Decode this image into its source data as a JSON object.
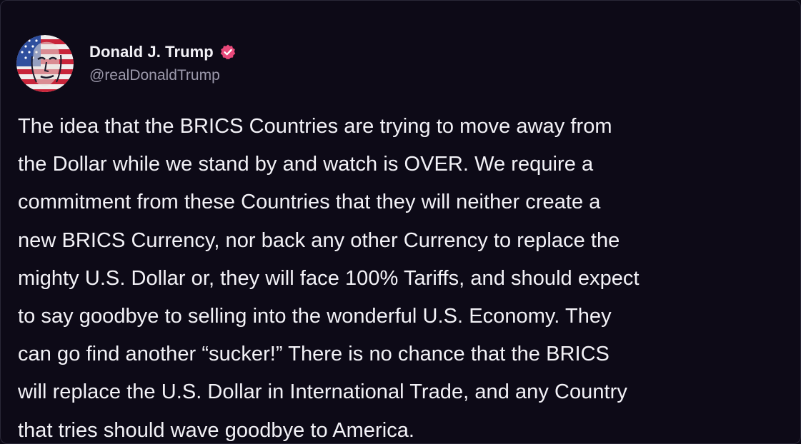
{
  "author": {
    "display_name": "Donald J. Trump",
    "handle": "@realDonaldTrump",
    "avatar_icon": "avatar-portrait-flag",
    "verified_icon": "verified-badge-icon",
    "verified_color": "#e8497a"
  },
  "post": {
    "lines": [
      "The idea that the BRICS Countries are trying to move away from",
      "the Dollar while we stand by and watch is OVER. We require a",
      "commitment from these Countries that they will neither create a",
      "new BRICS Currency, nor back any other Currency to replace the",
      "mighty U.S. Dollar or, they will face 100% Tariffs, and should expect",
      "to say goodbye to selling into the wonderful U.S. Economy. They",
      "can go find another “sucker!” There is no chance that the BRICS",
      "will replace the U.S. Dollar in International Trade, and any Country",
      "that tries should wave goodbye to America."
    ]
  },
  "colors": {
    "background": "#0d0a17",
    "text": "#f3f2f7",
    "handle": "#9c99ab"
  }
}
